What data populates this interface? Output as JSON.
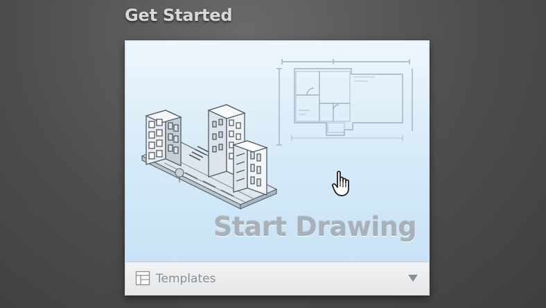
{
  "section": {
    "title": "Get Started"
  },
  "card": {
    "main_label": "Start Drawing",
    "templates_label": "Templates",
    "illustration": "city-and-floorplan-illustration",
    "cursor_icon": "hand-pointer-icon",
    "templates_icon": "template-icon",
    "dropdown_icon": "triangle-down-icon"
  },
  "colors": {
    "background": "#4d4d4d",
    "title_text": "#d8d8d8",
    "card_gradient_top": "#eef6fc",
    "card_gradient_bottom": "#c7e3f6",
    "start_label_text": "#a9b1b8",
    "footer_text": "#8a8f94"
  }
}
